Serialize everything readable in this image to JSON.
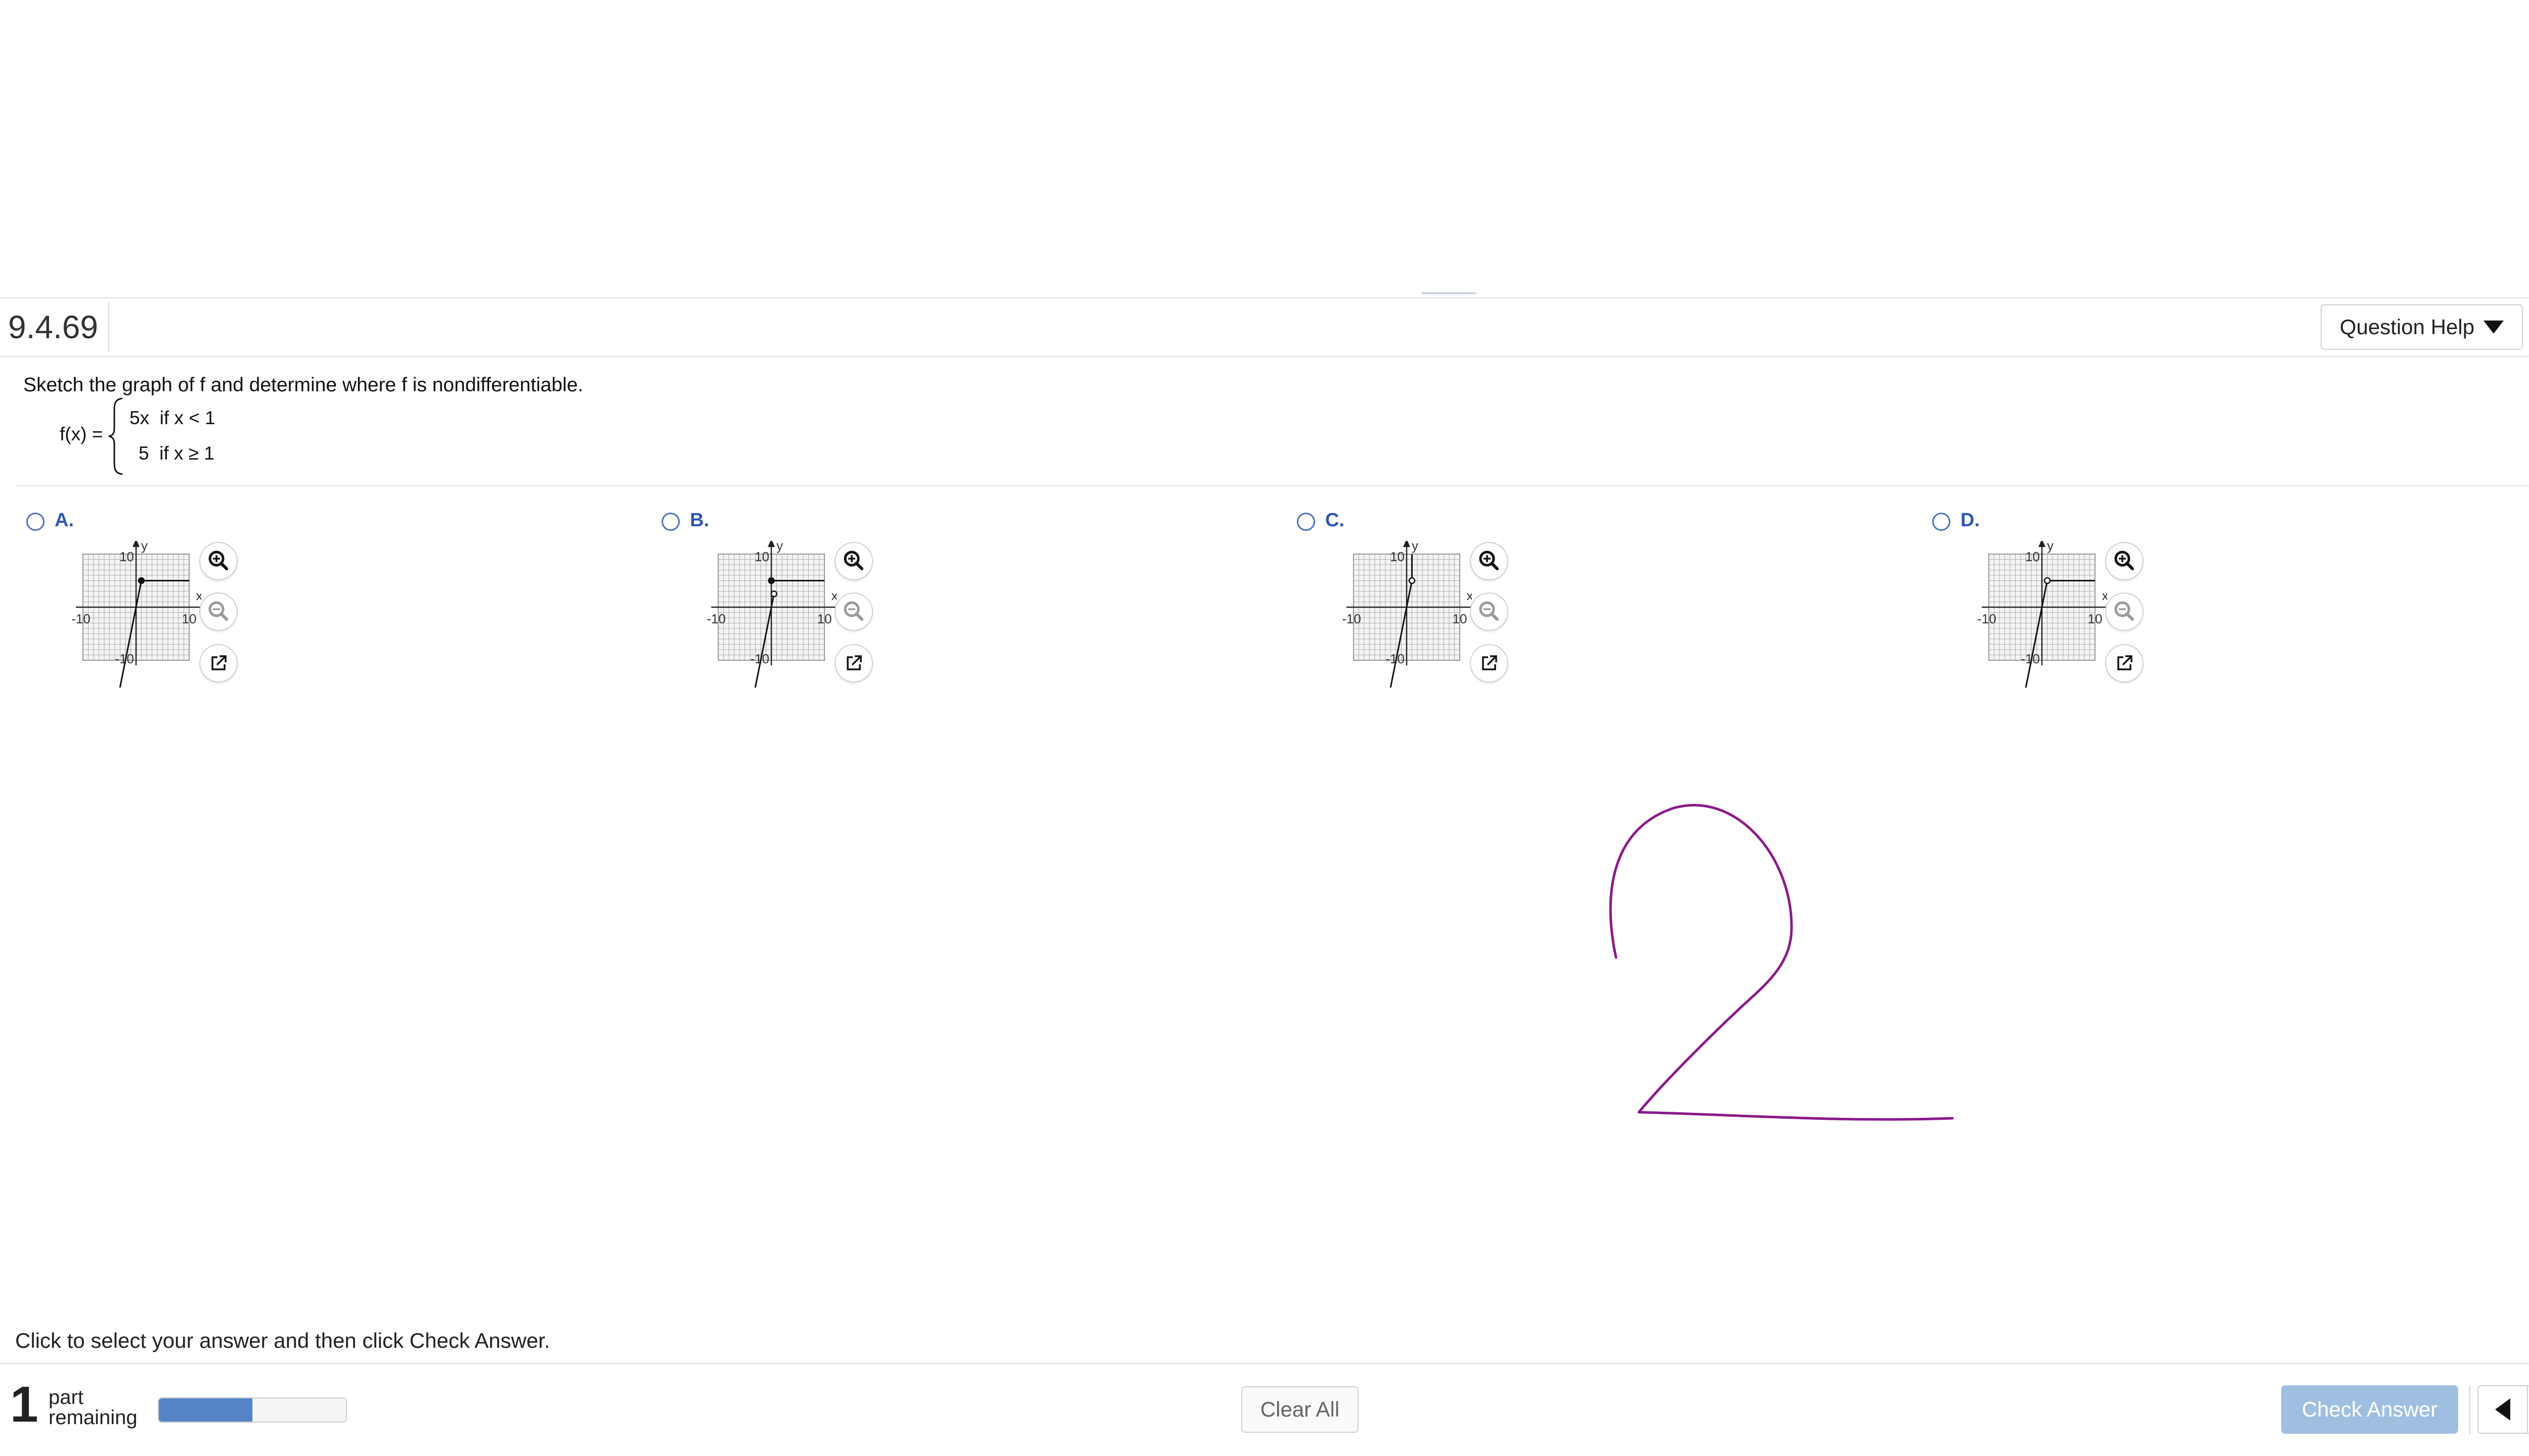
{
  "header": {
    "question_number": "9.4.69",
    "help_button_label": "Question Help"
  },
  "question": {
    "prompt": "Sketch the graph of f and determine where f is nondifferentiable.",
    "function_label": "f(x) =",
    "pieces": [
      "5x  if x < 1",
      "5  if x ≥ 1"
    ]
  },
  "choices": [
    {
      "letter": "A.",
      "axis": {
        "x_label": "x",
        "y_label": "y",
        "y_max_tick": "10",
        "y_min_tick": "-10",
        "x_min_tick": "-10",
        "x_max_tick": "10"
      }
    },
    {
      "letter": "B.",
      "axis": {
        "x_label": "x",
        "y_label": "y",
        "y_max_tick": "10",
        "y_min_tick": "-10",
        "x_min_tick": "-10",
        "x_max_tick": "10"
      }
    },
    {
      "letter": "C.",
      "axis": {
        "x_label": "x",
        "y_label": "y",
        "y_max_tick": "10",
        "y_min_tick": "-10",
        "x_min_tick": "-10",
        "x_max_tick": "10"
      }
    },
    {
      "letter": "D.",
      "axis": {
        "x_label": "x",
        "y_label": "y",
        "y_max_tick": "10",
        "y_min_tick": "-10",
        "x_min_tick": "-10",
        "x_max_tick": "10"
      }
    }
  ],
  "choice_icons": [
    "zoom-in-icon",
    "zoom-out-icon",
    "external-link-icon"
  ],
  "footer": {
    "instruction": "Click to select your answer and then click Check Answer.",
    "parts_count": "1",
    "parts_line1": "part",
    "parts_line2": "remaining",
    "progress": 0.5,
    "clear_all_label": "Clear All",
    "check_answer_label": "Check Answer"
  },
  "colors": {
    "accent": "#2f56b4",
    "progress_fill": "#5585c6",
    "check_answer_bg": "#9fbfe0",
    "scribble": "#8b1a8b",
    "help_icon": "#f0b81c"
  }
}
